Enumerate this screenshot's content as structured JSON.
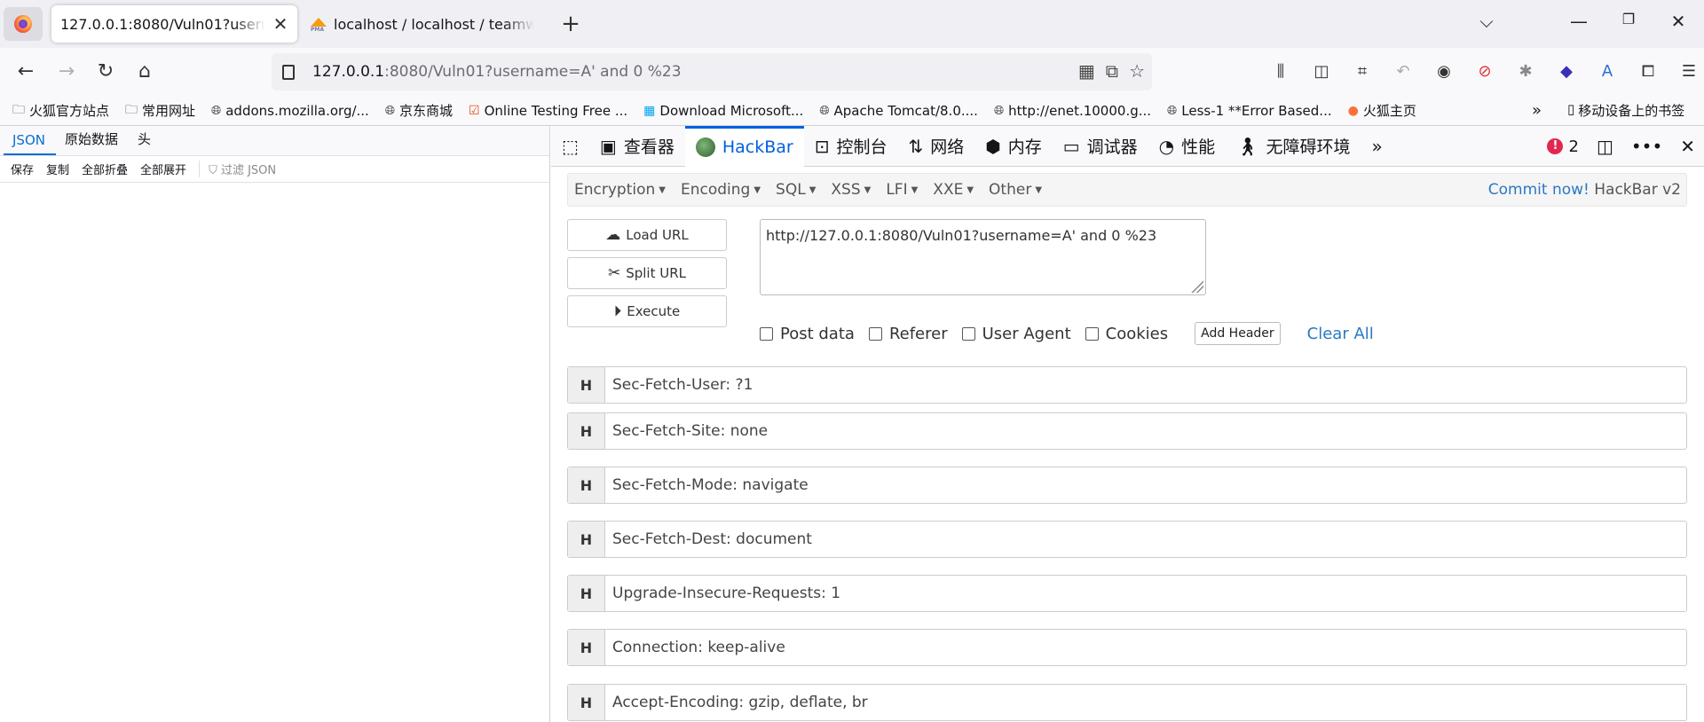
{
  "browser": {
    "tabs": [
      {
        "title": "127.0.0.1:8080/Vuln01?username=A' and 0 %23",
        "active": true
      },
      {
        "title": "localhost / localhost / teamwork",
        "active": false
      }
    ],
    "url": {
      "host": "127.0.0.1",
      "rest": ":8080/Vuln01?username=A' and 0 %23"
    },
    "bookmarks": [
      "火狐官方站点",
      "常用网址",
      "addons.mozilla.org/...",
      "京东商城",
      "Online Testing Free ...",
      "Download Microsoft...",
      "Apache Tomcat/8.0....",
      "http://enet.10000.g...",
      "Less-1 **Error Based...",
      "火狐主页"
    ],
    "bookmarks_mobile": "移动设备上的书签"
  },
  "json_viewer": {
    "tabs": [
      "JSON",
      "原始数据",
      "头"
    ],
    "tools": [
      "保存",
      "复制",
      "全部折叠",
      "全部展开"
    ],
    "filter_placeholder": "过滤 JSON"
  },
  "devtools": {
    "tabs": [
      "查看器",
      "HackBar",
      "控制台",
      "网络",
      "内存",
      "调试器",
      "性能",
      "无障碍环境"
    ],
    "error_count": "2"
  },
  "hackbar": {
    "menu": [
      "Encryption",
      "Encoding",
      "SQL",
      "XSS",
      "LFI",
      "XXE",
      "Other"
    ],
    "commit_link": "Commit now!",
    "version": "HackBar v2",
    "buttons": {
      "load": "Load URL",
      "split": "Split URL",
      "execute": "Execute"
    },
    "url_value": "http://127.0.0.1:8080/Vuln01?username=A' and 0 %23",
    "checks": [
      "Post data",
      "Referer",
      "User Agent",
      "Cookies"
    ],
    "add_header": "Add Header",
    "clear_all": "Clear All",
    "header_label": "H",
    "headers": [
      "Sec-Fetch-User: ?1",
      "Sec-Fetch-Site: none",
      "Sec-Fetch-Mode: navigate",
      "Sec-Fetch-Dest: document",
      "Upgrade-Insecure-Requests: 1",
      "Connection: keep-alive",
      "Accept-Encoding: gzip, deflate, br"
    ]
  }
}
